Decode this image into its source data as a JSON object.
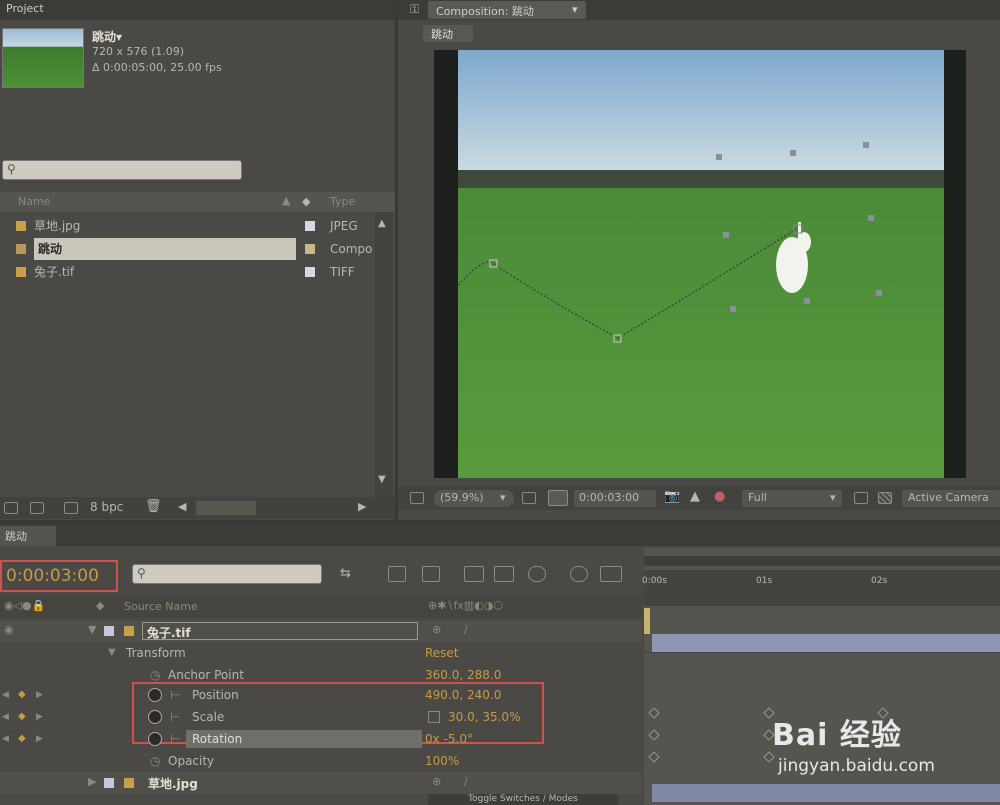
{
  "project": {
    "tab": "Project",
    "comp_name": "跳动▾",
    "comp_size": "720 x 576 (1.09)",
    "comp_duration": "Δ 0:00:05:00, 25.00 fps",
    "search_placeholder": "",
    "columns": {
      "name": "Name",
      "type": "Type"
    },
    "items": [
      {
        "name": "草地.jpg",
        "type": "JPEG"
      },
      {
        "name": "跳动",
        "type": "Compo"
      },
      {
        "name": "兔子.tif",
        "type": "TIFF"
      }
    ],
    "bpc": "8 bpc"
  },
  "composition": {
    "tab": "Composition: 跳动",
    "subtab": "跳动",
    "zoom": "(59.9%)",
    "timecode": "0:00:03:00",
    "resolution": "Full",
    "camera": "Active Camera"
  },
  "timeline": {
    "tab": "跳动",
    "timecode": "0:00:03:00",
    "source_name_header": "Source Name",
    "ruler": [
      "0:00s",
      "01s",
      "02s"
    ],
    "layer1": {
      "name": "兔子.tif"
    },
    "transform": {
      "label": "Transform",
      "reset": "Reset"
    },
    "anchor": {
      "label": "Anchor Point",
      "value": "360.0, 288.0"
    },
    "position": {
      "label": "Position",
      "value": "490.0, 240.0"
    },
    "scale": {
      "label": "Scale",
      "value": "30.0, 35.0%"
    },
    "rotation": {
      "label": "Rotation",
      "value": "0x -5.0°"
    },
    "opacity": {
      "label": "Opacity",
      "value": "100%"
    },
    "layer2": {
      "name": "草地.jpg"
    },
    "toggle": "Toggle Switches / Modes"
  },
  "watermark": {
    "brand": "Bai 经验",
    "url": "jingyan.baidu.com"
  }
}
